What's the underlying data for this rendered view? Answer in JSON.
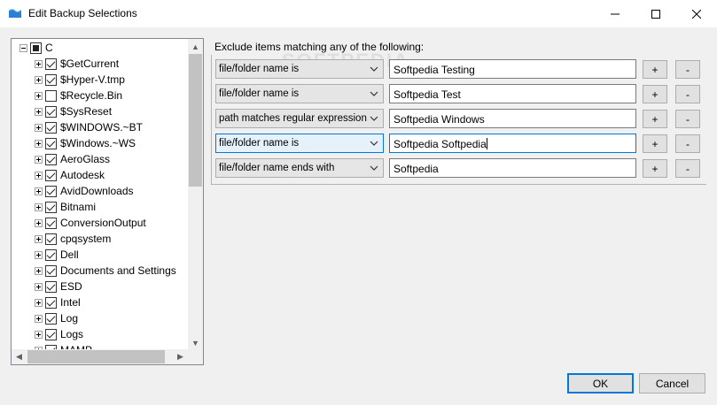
{
  "window": {
    "title": "Edit Backup Selections",
    "minimize_icon": "minimize-icon",
    "maximize_icon": "maximize-icon",
    "close_icon": "close-icon"
  },
  "tree": {
    "root": {
      "label": "C",
      "state": "partial"
    },
    "items": [
      {
        "label": "$GetCurrent",
        "checked": true
      },
      {
        "label": "$Hyper-V.tmp",
        "checked": true
      },
      {
        "label": "$Recycle.Bin",
        "checked": false
      },
      {
        "label": "$SysReset",
        "checked": true
      },
      {
        "label": "$WINDOWS.~BT",
        "checked": true
      },
      {
        "label": "$Windows.~WS",
        "checked": true
      },
      {
        "label": "AeroGlass",
        "checked": true
      },
      {
        "label": "Autodesk",
        "checked": true
      },
      {
        "label": "AvidDownloads",
        "checked": true
      },
      {
        "label": "Bitnami",
        "checked": true
      },
      {
        "label": "ConversionOutput",
        "checked": true
      },
      {
        "label": "cpqsystem",
        "checked": true
      },
      {
        "label": "Dell",
        "checked": true
      },
      {
        "label": "Documents and Settings",
        "checked": true
      },
      {
        "label": "ESD",
        "checked": true
      },
      {
        "label": "Intel",
        "checked": true
      },
      {
        "label": "Log",
        "checked": true
      },
      {
        "label": "Logs",
        "checked": true
      },
      {
        "label": "MAMP",
        "checked": true
      }
    ]
  },
  "rules": {
    "heading": "Exclude items matching any of the following:",
    "add_label": "+",
    "remove_label": "-",
    "rows": [
      {
        "type": "file/folder name is",
        "value": "Softpedia Testing",
        "focused": false
      },
      {
        "type": "file/folder name is",
        "value": "Softpedia Test",
        "focused": false
      },
      {
        "type": "path matches regular expression",
        "value": "Softpedia Windows",
        "focused": false
      },
      {
        "type": "file/folder name is",
        "value": "Softpedia Softpedia",
        "focused": true
      },
      {
        "type": "file/folder name ends with",
        "value": "Softpedia",
        "focused": false
      }
    ]
  },
  "buttons": {
    "ok": "OK",
    "cancel": "Cancel"
  },
  "watermark": "SOFTPEDIA",
  "colors": {
    "accent": "#0078d7",
    "button_face": "#e1e1e1",
    "window_bg": "#f0f0f0"
  }
}
